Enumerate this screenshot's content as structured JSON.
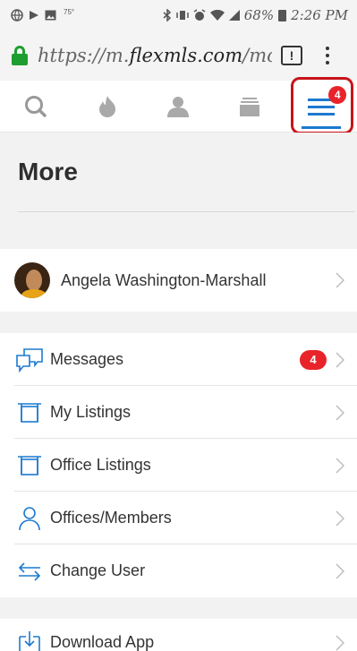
{
  "status_bar": {
    "left_small": "75°",
    "battery": "68%",
    "time": "2:26 PM"
  },
  "browser": {
    "url_prefix": "https://m.",
    "url_host": "flexmls.com",
    "url_suffix": "/mo",
    "tab_count": "!"
  },
  "nav": {
    "items": [
      {
        "icon": "search-icon"
      },
      {
        "icon": "flame-icon"
      },
      {
        "icon": "person-icon"
      },
      {
        "icon": "stack-icon"
      },
      {
        "icon": "hamburger-menu-icon",
        "badge": "4",
        "active": true
      }
    ],
    "accent_color": "#1c7ad0",
    "highlight_color": "#c8141b"
  },
  "page": {
    "title": "More"
  },
  "user": {
    "name": "Angela Washington-Marshall"
  },
  "menu": {
    "messages": {
      "label": "Messages",
      "badge": "4",
      "icon": "chat-bubbles-icon"
    },
    "my_listings": {
      "label": "My Listings",
      "icon": "listing-frame-icon"
    },
    "office_listings": {
      "label": "Office Listings",
      "icon": "listing-frame-icon"
    },
    "offices_members": {
      "label": "Offices/Members",
      "icon": "person-outline-icon"
    },
    "change_user": {
      "label": "Change User",
      "icon": "swap-arrows-icon"
    },
    "download_app": {
      "label": "Download App",
      "icon": "download-icon"
    }
  },
  "colors": {
    "badge": "#e8242a",
    "icon_blue": "#1c7ad0",
    "lock_green": "#1e9e2f"
  }
}
